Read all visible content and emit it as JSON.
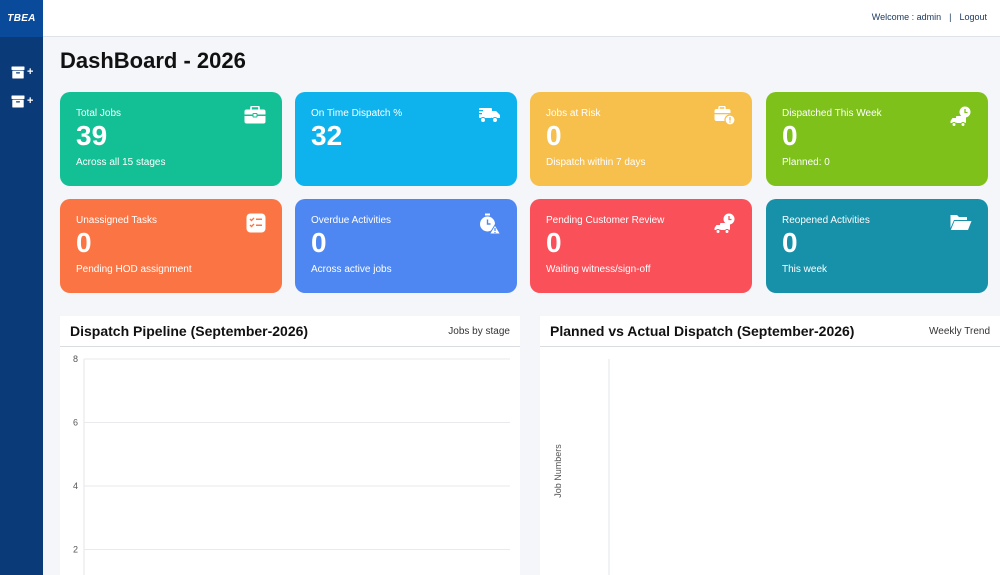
{
  "app": {
    "logo": "TBEA"
  },
  "topbar": {
    "welcome": "Welcome : admin",
    "separator": "|",
    "logout": "Logout"
  },
  "page": {
    "title": "DashBoard - 2026"
  },
  "cards": [
    {
      "label": "Total Jobs",
      "value": "39",
      "sub": "Across all 15 stages",
      "color": "#13bf94",
      "icon": "briefcase-icon"
    },
    {
      "label": "On Time Dispatch %",
      "value": "32",
      "sub": "",
      "color": "#0eb3ee",
      "icon": "truck-fast-icon"
    },
    {
      "label": "Jobs at Risk",
      "value": "0",
      "sub": "Dispatch within 7 days",
      "color": "#f7bf4b",
      "icon": "briefcase-alert-icon"
    },
    {
      "label": "Dispatched This Week",
      "value": "0",
      "sub": "Planned: 0",
      "color": "#7dc11a",
      "icon": "truck-clock-icon"
    },
    {
      "label": "Unassigned Tasks",
      "value": "0",
      "sub": "Pending HOD assignment",
      "color": "#fb7443",
      "icon": "task-list-icon"
    },
    {
      "label": "Overdue Activities",
      "value": "0",
      "sub": "Across active jobs",
      "color": "#4e87f1",
      "icon": "stopwatch-alert-icon"
    },
    {
      "label": "Pending Customer Review",
      "value": "0",
      "sub": "Waiting witness/sign-off",
      "color": "#f9505a",
      "icon": "truck-clock-icon"
    },
    {
      "label": "Reopened Activities",
      "value": "0",
      "sub": "This week",
      "color": "#1790a9",
      "icon": "folder-open-icon"
    }
  ],
  "panels": {
    "pipeline": {
      "title": "Dispatch Pipeline (September-2026)",
      "subtitle": "Jobs by stage"
    },
    "planned": {
      "title": "Planned vs Actual Dispatch (September-2026)",
      "subtitle": "Weekly Trend"
    }
  },
  "chart_data": [
    {
      "type": "bar",
      "title": "Dispatch Pipeline (September-2026)",
      "categories": [],
      "values": [],
      "ylim": [
        0,
        8
      ],
      "yticks": [
        "8",
        "6",
        "4",
        "2"
      ],
      "grid": true
    },
    {
      "type": "line",
      "title": "Planned vs Actual Dispatch (September-2026)",
      "ylabel": "Job Numbers",
      "series": [],
      "grid": false
    }
  ]
}
